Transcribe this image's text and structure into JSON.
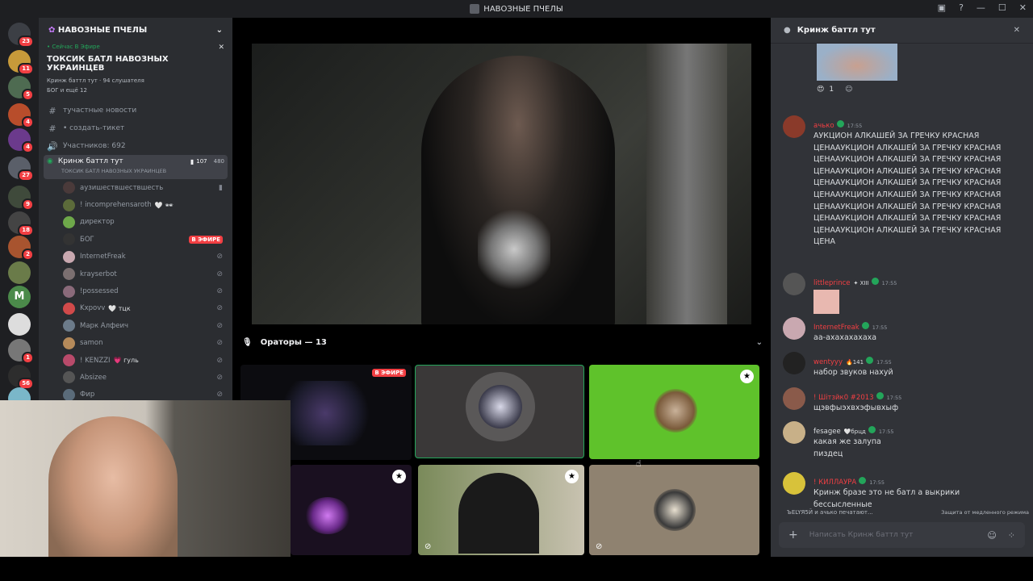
{
  "window": {
    "title": "НАВОЗНЫЕ ПЧЕЛЫ"
  },
  "guilds": [
    {
      "icon": "discord-home-icon",
      "badge": "23",
      "color": "#3c3f45"
    },
    {
      "icon": "server-icon",
      "badge": "11",
      "color": "#c79a3a"
    },
    {
      "icon": "server-icon",
      "badge": "5",
      "color": "#4e6b51"
    },
    {
      "icon": "server-icon",
      "badge": "4",
      "color": "#b84d2b"
    },
    {
      "icon": "server-icon",
      "badge": "4",
      "color": "#6b3a8c"
    },
    {
      "icon": "server-icon",
      "badge": "27",
      "color": "#5a5f69"
    },
    {
      "icon": "server-icon",
      "badge": "9",
      "color": "#3f4a3b"
    },
    {
      "icon": "server-icon",
      "badge": "18",
      "color": "#444"
    },
    {
      "icon": "server-icon",
      "badge": "2",
      "color": "#a8542f"
    },
    {
      "icon": "server-icon",
      "badge": "",
      "color": "#6a7b49"
    },
    {
      "icon": "server-icon",
      "badge": "",
      "color": "#4b8a4a",
      "letter": "M"
    },
    {
      "icon": "server-icon",
      "badge": "",
      "color": "#ddd"
    },
    {
      "icon": "server-icon",
      "badge": "1",
      "color": "#777"
    },
    {
      "icon": "server-icon",
      "badge": "56",
      "color": "#2d2d2d"
    },
    {
      "icon": "server-icon",
      "badge": "",
      "color": "#7ab7c9"
    }
  ],
  "server": {
    "name": "НАВОЗНЫЕ ПЧЕЛЫ",
    "live_now": "• Сейчас В Эфире",
    "stage_title": "ТОКСИК БАТЛ НАВОЗНЫХ УКРАИНЦЕВ",
    "stage_meta": "Кринж баттл тут · 94 слушателя",
    "stage_hosts": "БОГ и ещё 12",
    "channels": [
      {
        "name": "тучастные новости"
      },
      {
        "name": "• создать-тикет"
      },
      {
        "name": "Участников: 692"
      }
    ],
    "active_channel": {
      "name": "Кринж баттл тут",
      "sub": "ТОКСИК БАТЛ НАВОЗНЫХ УКРАИНЦЕВ",
      "count1": "107",
      "count2": "480"
    },
    "members": [
      {
        "name": "аузишествшествшесть",
        "color": "#4a3a3a"
      },
      {
        "name": "! incomprehensaroth",
        "color": "#5c6b3a",
        "tag": "🤍 🕶"
      },
      {
        "name": "директор",
        "color": "#6ea84a"
      },
      {
        "name": "БОГ",
        "color": "#333",
        "live": "В ЭФИРЕ"
      },
      {
        "name": "InternetFreak",
        "color": "#c9a8b0"
      },
      {
        "name": "krayserbot",
        "color": "#7b6f70"
      },
      {
        "name": "!possessed",
        "color": "#8a6a7a"
      },
      {
        "name": "Kxpovv",
        "color": "#d14a4a",
        "tag": "🤍 тцк"
      },
      {
        "name": "Марк Алфеич",
        "color": "#6c7b8a"
      },
      {
        "name": "samon",
        "color": "#b58a5a"
      },
      {
        "name": "! KENZZI",
        "color": "#b84a6a",
        "tag": "💗 гуль"
      },
      {
        "name": "Absizee",
        "color": "#555"
      },
      {
        "name": "Фир",
        "color": "#5a6b7a"
      }
    ],
    "live_label": "В ЭФИРЕ"
  },
  "stage": {
    "speakers_label": "Ораторы — 13",
    "tile_live_label": "В ЭФИРЕ"
  },
  "chat": {
    "channel": "Кринж баттл тут",
    "reaction_count": "1",
    "messages": [
      {
        "user": "ачько",
        "color": "#f23f43",
        "time": "17:55",
        "text": "АУКЦИОН АЛКАШЕЙ ЗА ГРЕЧКУ КРАСНАЯ\nЦЕНААУКЦИОН АЛКАШЕЙ ЗА ГРЕЧКУ КРАСНАЯ\nЦЕНААУКЦИОН АЛКАШЕЙ ЗА ГРЕЧКУ КРАСНАЯ\nЦЕНААУКЦИОН АЛКАШЕЙ ЗА ГРЕЧКУ КРАСНАЯ\nЦЕНААУКЦИОН АЛКАШЕЙ ЗА ГРЕЧКУ КРАСНАЯ\nЦЕНААУКЦИОН АЛКАШЕЙ ЗА ГРЕЧКУ КРАСНАЯ\nЦЕНААУКЦИОН АЛКАШЕЙ ЗА ГРЕЧКУ КРАСНАЯ\nЦЕНААУКЦИОН АЛКАШЕЙ ЗА ГРЕЧКУ КРАСНАЯ\nЦЕНААУКЦИОН АЛКАШЕЙ ЗА ГРЕЧКУ КРАСНАЯ\nЦЕНА",
        "avatar": "#8a3a2a"
      },
      {
        "user": "littleprince",
        "color": "#f23f43",
        "time": "17:55",
        "tag": "✦ XIII",
        "text": "",
        "avatar": "#555"
      },
      {
        "user": "InternetFreak",
        "color": "#f23f43",
        "time": "17:55",
        "text": "аа-ахахахахаха",
        "avatar": "#c9a8b0"
      },
      {
        "user": "wentyyy",
        "color": "#f23f43",
        "time": "17:55",
        "tag": "🔥141",
        "text": "набор звуков нахуй",
        "avatar": "#222"
      },
      {
        "user": "! Шітзйк0 #2013",
        "color": "#f23f43",
        "time": "17:55",
        "text": "щэвфыэхвхэфывхыф",
        "avatar": "#8a5a4a"
      },
      {
        "user": "fesagee",
        "color": "#dbdee1",
        "time": "17:55",
        "tag": "🤍брцд",
        "text": "какая же залупа\nпиздец",
        "avatar": "#c8b088"
      },
      {
        "user": "! КИЛЛАУРА",
        "color": "#f23f43",
        "time": "17:55",
        "text": "Кринж бразе это не батл а выкрики\nбессысленные",
        "avatar": "#d8c23a"
      }
    ],
    "typing": "ЪELYЯ5Й и ачько печатают...",
    "slowmode": "Защита от медленного режима",
    "composer_placeholder": "Написать Кринж баттл тут"
  },
  "colors": {
    "accent": "#23a55a",
    "danger": "#f23f43",
    "bg": "#313338",
    "sidebar": "#2b2d31"
  }
}
